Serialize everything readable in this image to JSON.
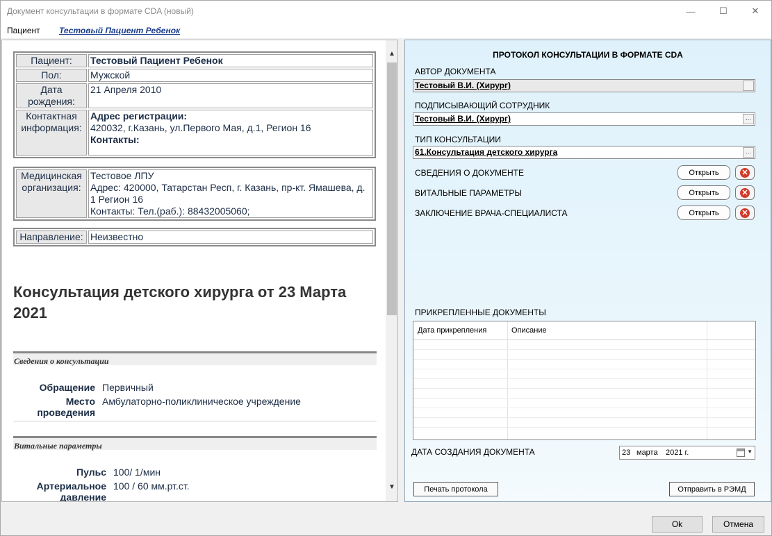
{
  "window": {
    "title": "Документ консультации в формате CDA (новый)",
    "minimize_glyph": "—",
    "maximize_glyph": "☐",
    "close_glyph": "✕"
  },
  "patient_bar": {
    "label": "Пациент",
    "name": "Тестовый Пациент Ребенок"
  },
  "document": {
    "patient_table": {
      "patient_label": "Пациент:",
      "patient_value": "Тестовый Пациент Ребенок",
      "sex_label": "Пол:",
      "sex_value": "Мужской",
      "dob_label_1": "Дата",
      "dob_label_2": "рождения:",
      "dob_value": "21 Апреля 2010",
      "contact_label_1": "Контактная",
      "contact_label_2": "информация:",
      "reg_address_label": "Адрес регистрации:",
      "reg_address_value": "420032, г.Казань, ул.Первого Мая, д.1, Регион 16",
      "contacts_label": "Контакты:"
    },
    "org_table": {
      "label_1": "Медицинская",
      "label_2": "организация:",
      "name": "Тестовое ЛПУ",
      "address": "Адрес: 420000, Татарстан Респ, г. Казань, пр-кт. Ямашева, д. 1 Регион 16",
      "contacts": "Контакты: Тел.(раб.): 88432005060;"
    },
    "referral_table": {
      "label": "Направление:",
      "value": "Неизвестно"
    },
    "heading": "Консультация детского хирурга от 23 Марта 2021",
    "section_consultation": {
      "title": "Сведения о консультации",
      "appeal_label": "Обращение",
      "appeal_value": "Первичный",
      "place_label_1": "Место",
      "place_label_2": "проведения",
      "place_value": "Амбулаторно-поликлиническое учреждение"
    },
    "section_vitals": {
      "title": "Витальные параметры",
      "pulse_label": "Пульс",
      "pulse_value": "100/ 1/мин",
      "bp_label_1": "Артериальное",
      "bp_label_2": "давление",
      "bp_value": "100 / 60 мм.рт.ст."
    }
  },
  "protocol": {
    "title": "ПРОТОКОЛ КОНСУЛЬТАЦИИ В ФОРМАТЕ CDA",
    "author_label": "АВТОР ДОКУМЕНТА",
    "author_value": "Тестовый В.И. (Хирург)",
    "signer_label": "ПОДПИСЫВАЮЩИЙ СОТРУДНИК",
    "signer_value": "Тестовый В.И. (Хирург)",
    "type_label": "ТИП КОНСУЛЬТАЦИИ",
    "type_value": "61.Консультация детского хирурга",
    "ellipsis": "...",
    "sections": [
      {
        "label": "СВЕДЕНИЯ О ДОКУМЕНТЕ",
        "button": "Открыть"
      },
      {
        "label": "ВИТАЛЬНЫЕ ПАРАМЕТРЫ",
        "button": "Открыть"
      },
      {
        "label": "ЗАКЛЮЧЕНИЕ ВРАЧА-СПЕЦИАЛИСТА",
        "button": "Открыть"
      }
    ],
    "delete_glyph": "✕",
    "attached_label": "ПРИКРЕПЛЕННЫЕ ДОКУМЕНТЫ",
    "attached_columns": [
      "Дата прикрепления",
      "Описание"
    ],
    "created_date_label": "ДАТА СОЗДАНИЯ ДОКУМЕНТА",
    "created_date": {
      "day": "23",
      "month": "марта",
      "year": "2021 г."
    },
    "print_button": "Печать протокола",
    "send_button": "Отправить в РЭМД"
  },
  "footer": {
    "ok_button": "Ok",
    "cancel_button": "Отмена"
  }
}
